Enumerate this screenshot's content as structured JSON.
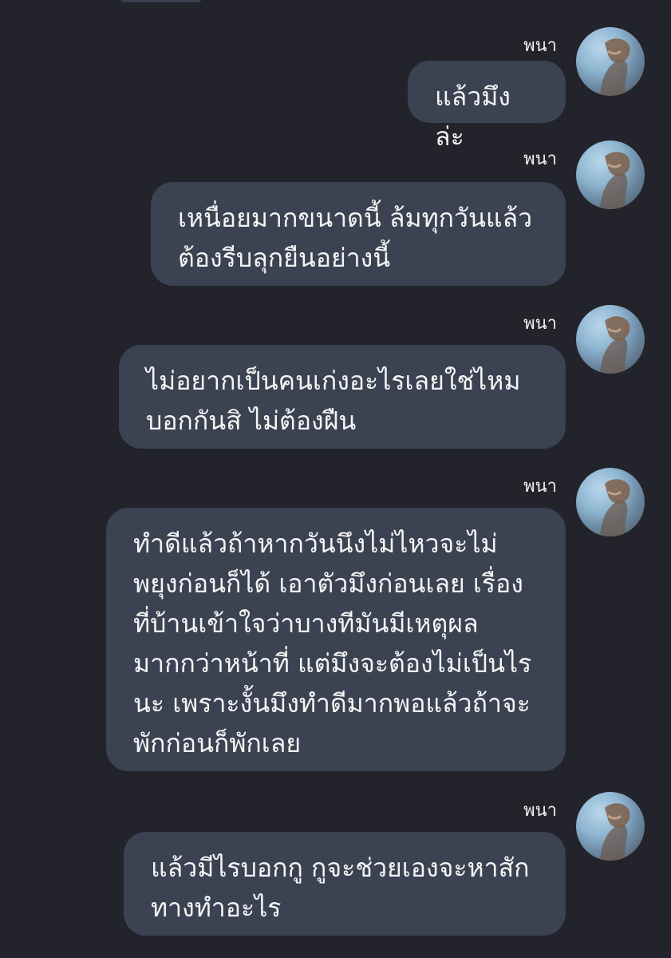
{
  "chat": {
    "messages": [
      {
        "sender": "พนา",
        "avatar_icon": "profile-photo-avatar",
        "text": "แล้วมึงล่ะ"
      },
      {
        "sender": "พนา",
        "avatar_icon": "profile-photo-avatar",
        "text": "เหนื่อยมากขนาดนี้ ล้มทุกวันแล้ว\nต้องรีบลุกยืนอย่างนี้"
      },
      {
        "sender": "พนา",
        "avatar_icon": "profile-photo-avatar",
        "text": "ไม่อยากเป็นคนเก่งอะไรเลยใช่ไหม\nบอกกันสิ ไม่ต้องฝืน"
      },
      {
        "sender": "พนา",
        "avatar_icon": "profile-photo-avatar",
        "text": "ทำดีแล้วถ้าหากวันนึงไม่ไหวจะไม่\nพยุงก่อนก็ได้ เอาตัวมึงก่อนเลย เรื่อง\nที่บ้านเข้าใจว่าบางทีมันมีเหตุผล\nมากกว่าหน้าที่ แต่มึงจะต้องไม่เป็นไร\nนะ เพราะงั้นมึงทำดีมากพอแล้วถ้าจะ\nพักก่อนก็พักเลย"
      },
      {
        "sender": "พนา",
        "avatar_icon": "profile-photo-avatar",
        "text": "แล้วมีไรบอกกู กูจะช่วยเองจะหาสัก\nทางทำอะไร"
      }
    ]
  },
  "colors": {
    "background": "#22232b",
    "bubble": "#3b4252",
    "text": "#f4f4f4"
  }
}
